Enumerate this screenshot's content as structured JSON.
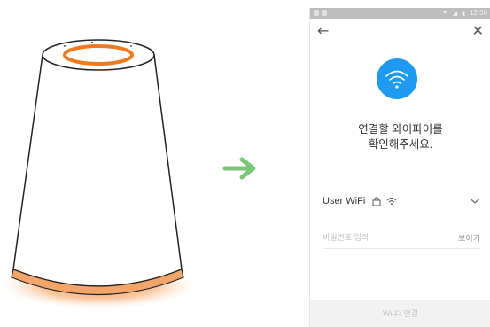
{
  "status_bar": {
    "time": "12:30",
    "signal_icon": "signal-icon",
    "battery_icon": "battery-icon"
  },
  "nav": {
    "back_icon": "arrow-left-icon",
    "back_glyph": "←",
    "close_icon": "close-icon",
    "close_glyph": "✕"
  },
  "wifi_badge": {
    "icon": "wifi-icon",
    "color": "#1e9bf0"
  },
  "heading": {
    "line1": "연결할 와이파이를",
    "line2": "확인해주세요."
  },
  "network": {
    "ssid": "User WiFi",
    "lock_icon": "lock-icon",
    "wifi_icon": "wifi-signal-icon",
    "dropdown_icon": "chevron-down-icon"
  },
  "password": {
    "placeholder": "비밀번호 입력",
    "show_label": "보이기"
  },
  "connect_button": {
    "label": "Wi-Fi 연결"
  },
  "illustration": {
    "arrow_color": "#7cc67a",
    "glow_color": "#f08a3a",
    "device_icon": "smart-speaker-icon"
  }
}
